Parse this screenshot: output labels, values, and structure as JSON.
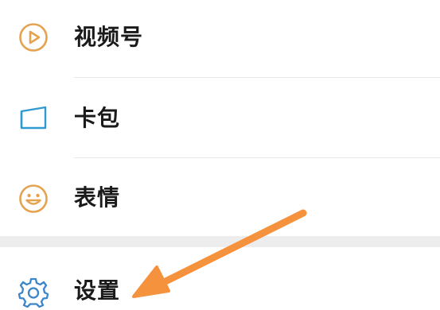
{
  "menu": {
    "items": [
      {
        "label": "视频号",
        "icon": "play-circle-icon"
      },
      {
        "label": "卡包",
        "icon": "card-wallet-icon"
      },
      {
        "label": "表情",
        "icon": "smiley-face-icon"
      },
      {
        "label": "设置",
        "icon": "gear-icon"
      }
    ]
  },
  "annotation": {
    "arrow_color": "#f5923e",
    "target": "设置"
  },
  "colors": {
    "play_icon": "#e5a24f",
    "card_icon": "#2e9ad1",
    "smiley_icon": "#e5a24f",
    "gear_icon": "#3b86c9",
    "section_gap": "#ededed",
    "divider": "#e6e6e6"
  }
}
